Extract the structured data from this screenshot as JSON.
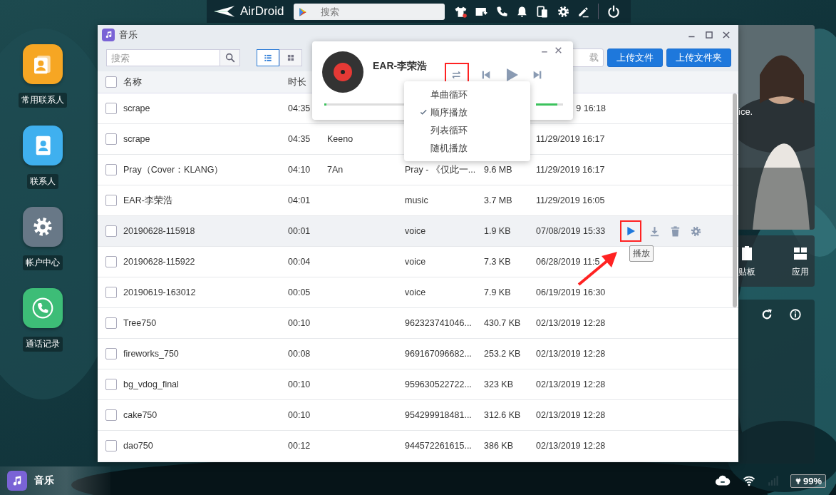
{
  "top_bar": {
    "brand": "AirDroid",
    "search": {
      "placeholder": "搜索"
    }
  },
  "desktop_icons": [
    {
      "label": "常用联系人",
      "kind": "favorites",
      "color": "#f6a623"
    },
    {
      "label": "联系人",
      "kind": "contacts",
      "color": "#3fb0ef"
    },
    {
      "label": "帐户中心",
      "kind": "account",
      "color": "#687887"
    },
    {
      "label": "通话记录",
      "kind": "calls",
      "color": "#3dbd77"
    }
  ],
  "window": {
    "title": "音乐",
    "search": {
      "placeholder": "搜索"
    },
    "views": [
      {
        "kind": "list",
        "selected": true
      },
      {
        "kind": "grid",
        "selected": false
      }
    ],
    "buttons": [
      {
        "label": "载",
        "kind": "plain"
      },
      {
        "label": "上传文件",
        "kind": "primary"
      },
      {
        "label": "上传文件夹",
        "kind": "primary"
      }
    ],
    "header": {
      "checked": false,
      "columns": [
        "名称",
        "时长"
      ]
    },
    "rows": [
      {
        "checked": false,
        "highlighted": false,
        "name": "scrape",
        "duration": "04:35",
        "date_end": "9 16:18"
      },
      {
        "checked": false,
        "highlighted": false,
        "name": "scrape",
        "duration": "04:35",
        "artist": "Keeno",
        "date": "11/29/2019 16:17"
      },
      {
        "checked": false,
        "highlighted": false,
        "name": "Pray（Cover：KLANG）",
        "duration": "04:10",
        "artist": "7An",
        "album": "Pray - 《仅此一...",
        "size": "9.6 MB",
        "date": "11/29/2019 16:17"
      },
      {
        "checked": false,
        "highlighted": false,
        "name": "EAR-李荣浩",
        "duration": "04:01",
        "album": "music",
        "size": "3.7 MB",
        "date": "11/29/2019 16:05"
      },
      {
        "checked": false,
        "highlighted": true,
        "name": "20190628-115918",
        "duration": "00:01",
        "album": "voice",
        "size": "1.9 KB",
        "date": "07/08/2019 15:33"
      },
      {
        "checked": false,
        "highlighted": false,
        "name": "20190628-115922",
        "duration": "00:04",
        "album": "voice",
        "size": "7.3 KB",
        "date": "06/28/2019 11:5"
      },
      {
        "checked": false,
        "highlighted": false,
        "name": "20190619-163012",
        "duration": "00:05",
        "album": "voice",
        "size": "7.9 KB",
        "date": "06/19/2019 16:30"
      },
      {
        "checked": false,
        "highlighted": false,
        "name": "Tree750",
        "duration": "00:10",
        "album": "962323741046...",
        "size": "430.7 KB",
        "date": "02/13/2019 12:28"
      },
      {
        "checked": false,
        "highlighted": false,
        "name": "fireworks_750",
        "duration": "00:08",
        "album": "969167096682...",
        "size": "253.2 KB",
        "date": "02/13/2019 12:28"
      },
      {
        "checked": false,
        "highlighted": false,
        "name": "bg_vdog_final",
        "duration": "00:10",
        "album": "959630522722...",
        "size": "323 KB",
        "date": "02/13/2019 12:28"
      },
      {
        "checked": false,
        "highlighted": false,
        "name": "cake750",
        "duration": "00:10",
        "album": "954299918481...",
        "size": "312.6 KB",
        "date": "02/13/2019 12:28"
      },
      {
        "checked": false,
        "highlighted": false,
        "name": "dao750",
        "duration": "00:12",
        "album": "944572261615...",
        "size": "386 KB",
        "date": "02/13/2019 12:28"
      }
    ],
    "tooltip": "播放"
  },
  "player": {
    "title": "EAR-李荣浩",
    "progress": {
      "level": 0.01
    },
    "volume": {
      "level": 0.8
    },
    "play_mode_menu": [
      {
        "label": "单曲循环",
        "selected": false
      },
      {
        "label": "顺序播放",
        "selected": true
      },
      {
        "label": "列表循环",
        "selected": false
      },
      {
        "label": "随机播放",
        "selected": false
      }
    ]
  },
  "side_widgets": {
    "caption": "ice.",
    "shortcuts": [
      {
        "label": "贴板",
        "kind": "clipboard"
      },
      {
        "label": "应用",
        "kind": "apps"
      }
    ]
  },
  "taskbar": {
    "app": "音乐",
    "battery": "99%"
  }
}
